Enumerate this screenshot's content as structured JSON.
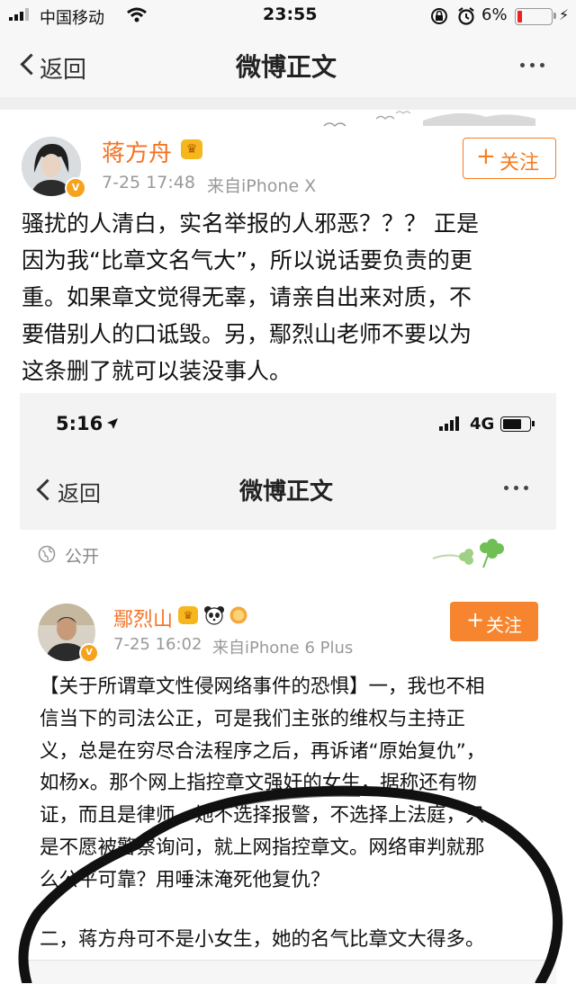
{
  "status_bar": {
    "carrier": "中国移动",
    "time": "23:55",
    "battery": "6%"
  },
  "nav": {
    "back_label": "返回",
    "title": "微博正文"
  },
  "post": {
    "author": "蒋方舟",
    "time": "7-25 17:48",
    "source": "来自iPhone X",
    "follow_label": "关注",
    "lines": [
      "骚扰的人清白，实名举报的人邪恶？？？ 正是",
      "因为我“比章文名气大”，所以说话要负责的更",
      "重。如果章文觉得无辜，请亲自出来对质，不",
      "要借别人的口诋毁。另，鄢烈山老师不要以为",
      "这条删了就可以装没事人。"
    ]
  },
  "embedded": {
    "status_time": "5:16",
    "network": "4G",
    "back_label": "返回",
    "title": "微博正文",
    "visibility": "公开",
    "author": "鄢烈山",
    "time": "7-25 16:02",
    "source": "来自iPhone 6 Plus",
    "follow_label": "关注",
    "lines": [
      "【关于所谓章文性侵网络事件的恐惧】一，我也不相",
      "信当下的司法公正，可是我们主张的维权与主持正",
      "义，总是在穷尽合法程序之后，再诉诸“原始复仇”，",
      "如杨x。那个网上指控章文强奸的女生，据称还有物",
      "证，而且是律师，她不选择报警，不选择上法庭，只",
      "是不愿被警察询问，就上网指控章文。网络审判就那",
      "么公平可靠？用唾沫淹死他复仇？"
    ],
    "line2": "二，蒋方舟可不是小女生，她的名气比章文大得多。"
  },
  "colors": {
    "accent": "#f77c21",
    "link_blue": "#3b74b9",
    "badge": "#f7a21b"
  }
}
